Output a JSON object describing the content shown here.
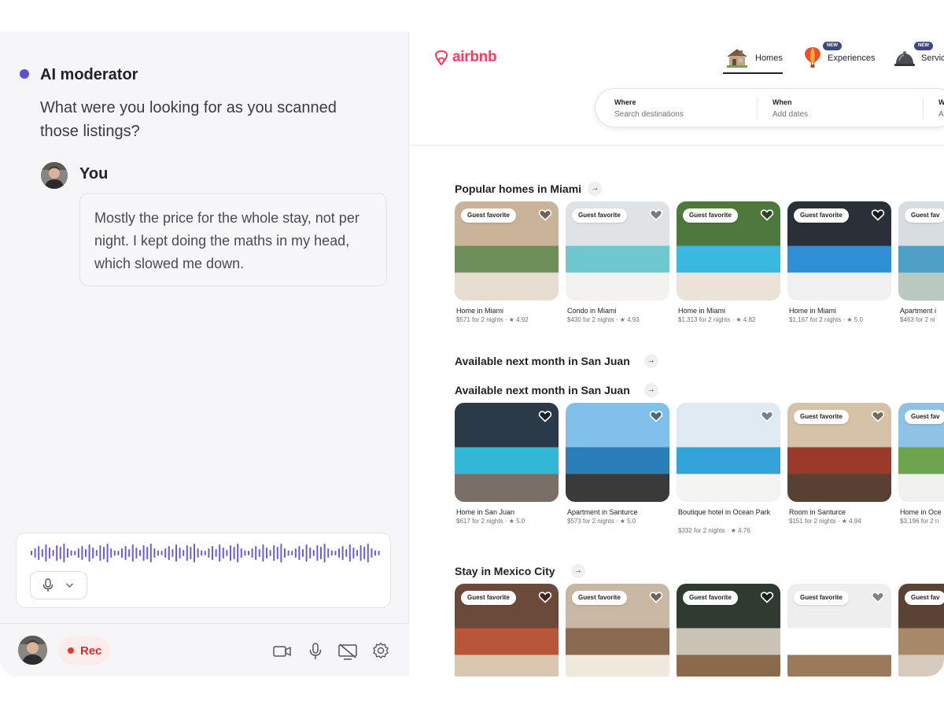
{
  "chat": {
    "moderator_name": "AI moderator",
    "moderator_question": "What were you looking for as you scanned those listings?",
    "user_name": "You",
    "user_answer": "Mostly the price for the whole stay, not per night. I kept doing the maths in my head, which slowed me down."
  },
  "recorder": {
    "rec_label": "Rec",
    "controls": [
      "video-icon",
      "microphone-icon",
      "screen-share-icon",
      "settings-icon"
    ],
    "mic_select_icon": "microphone-icon"
  },
  "airbnb": {
    "logo_text": "airbnb",
    "brand_color": "#ff385c",
    "nav": [
      {
        "label": "Homes",
        "icon": "house-icon",
        "badge": ""
      },
      {
        "label": "Experiences",
        "icon": "hot-air-balloon-icon",
        "badge": "NEW"
      },
      {
        "label": "Servic",
        "icon": "service-bell-icon",
        "badge": "NEW"
      }
    ],
    "search": {
      "where_label": "Where",
      "where_value": "Search destinations",
      "when_label": "When",
      "when_value": "Add dates",
      "who_label": "W",
      "who_value": "A"
    },
    "sections": [
      {
        "title": "Popular homes in Miami",
        "cards": [
          {
            "badge": "Guest favorite",
            "title": "Home in Miami",
            "sub": "$571 for 2 nights · ★ 4.92"
          },
          {
            "badge": "Guest favorite",
            "title": "Condo in Miami",
            "sub": "$430 for 2 nights · ★ 4.93"
          },
          {
            "badge": "Guest favorite",
            "title": "Home in Miami",
            "sub": "$1,313 for 2 nights · ★ 4.82"
          },
          {
            "badge": "Guest favorite",
            "title": "Home in Miami",
            "sub": "$1,167 for 2 nights · ★ 5.0"
          },
          {
            "badge": "Guest fav",
            "title": "Apartment i",
            "sub": "$463 for 2 ni"
          }
        ]
      },
      {
        "title": "Available next month in San Juan"
      },
      {
        "title": "Available next month in San Juan",
        "cards": [
          {
            "badge": "",
            "title": "Home in San Juan",
            "sub": "$617 for 2 nights · ★ 5.0"
          },
          {
            "badge": "",
            "title": "Apartment in Santurce",
            "sub": "$573 for 2 nights · ★ 5.0"
          },
          {
            "badge": "",
            "title": "Boutique hotel in Ocean Park",
            "sub": "$332 for 2 nights · ★ 4.76"
          },
          {
            "badge": "Guest favorite",
            "title": "Room in Santurce",
            "sub": "$151 for 2 nights · ★ 4.94"
          },
          {
            "badge": "Guest fav",
            "title": "Home in Oce",
            "sub": "$3,196 for 2 n"
          }
        ]
      },
      {
        "title": "Stay in Mexico City",
        "cards": [
          {
            "badge": "Guest favorite",
            "title": "",
            "sub": ""
          },
          {
            "badge": "Guest favorite",
            "title": "",
            "sub": ""
          },
          {
            "badge": "Guest favorite",
            "title": "",
            "sub": ""
          },
          {
            "badge": "Guest favorite",
            "title": "",
            "sub": ""
          },
          {
            "badge": "Guest fav",
            "title": "",
            "sub": ""
          }
        ]
      }
    ]
  }
}
